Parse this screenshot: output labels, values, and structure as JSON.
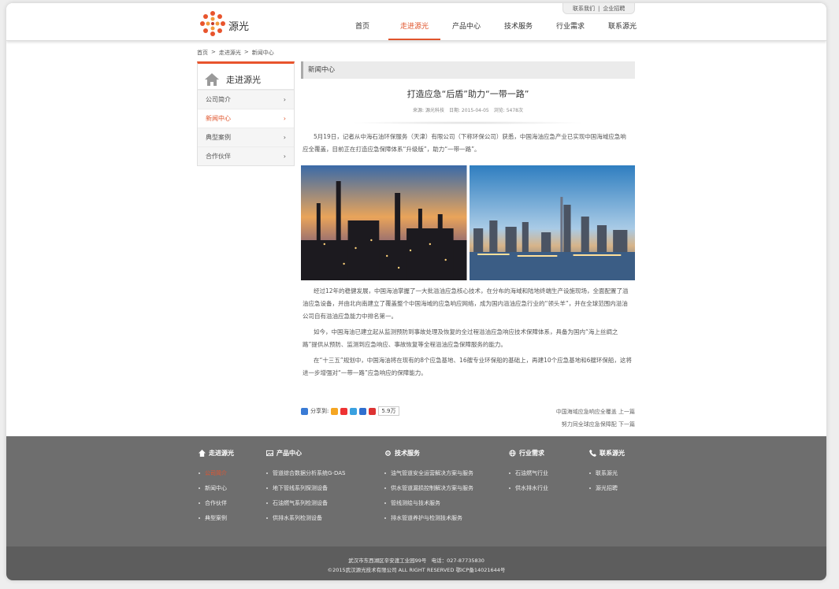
{
  "header": {
    "logo_text": "源光",
    "logo_subtext": "",
    "top_links": [
      "联系我们",
      "企业招聘"
    ],
    "top_links_sep": "|",
    "nav": [
      {
        "label": "首页"
      },
      {
        "label": "走进源光"
      },
      {
        "label": "产品中心"
      },
      {
        "label": "技术服务"
      },
      {
        "label": "行业需求"
      },
      {
        "label": "联系源光"
      }
    ],
    "nav_active": "走进源光"
  },
  "breadcrumb": [
    "首页",
    "走进源光",
    "新闻中心"
  ],
  "breadcrumb_sep": ">",
  "sidebar": {
    "title": "走进源光",
    "items": [
      {
        "label": "公司简介",
        "active": false
      },
      {
        "label": "新闻中心",
        "active": true
      },
      {
        "label": "典型案例",
        "active": false
      },
      {
        "label": "合作伙伴",
        "active": false
      }
    ],
    "chevron": "›"
  },
  "content": {
    "section_title": "新闻中心",
    "article_title": "打造应急“后盾”助力“一带一路”",
    "meta_source": "来源: 源光科技",
    "meta_date": "日期: 2015-04-05",
    "meta_views": "浏览: 5478次",
    "paragraphs": [
      "5月19日，记者从中海石油环保服务（天津）有限公司（下称环保公司）获悉，中国海油应急产业已实现中国海域应急响应全覆盖，目前正在打造应急保障体系“升级版”，助力“一带一路”。",
      "经过12年的稳健发展，中国海油掌握了一大批溢油应急核心技术，在分布的海域和陆地终端生产设施现场，全面配置了溢油应急设备，并由北向南建立了覆盖整个中国海域的应急响应网络，成为国内溢油应急行业的“领头羊”，并在全球范围内溢油公司自有溢油应急能力中排名第一。",
      "如今，中国海油已建立起从监测预防到事故处理及恢复的全过程溢油应急响应技术保障体系，具备为国内“海上丝绸之路”提供从预防、监测到应急响应、事故恢复等全程溢油应急保障服务的能力。",
      "在“十三五”规划中，中国海油将在现有的8个应急基地、16艘专业环保船的基础上，再建10个应急基地和6艘环保船，这将进一步增强对“一带一路”应急响应的保障能力。"
    ],
    "share_label": "分享到:",
    "share_count": "5.9万",
    "prev_link": "中国海域应急响应全覆盖 上一篇",
    "next_link": "努力同全球应急保障配 下一篇"
  },
  "footer": {
    "columns": [
      {
        "title": "走进源光",
        "icon": "home-icon",
        "links": [
          "公司简介",
          "新闻中心",
          "合作伙伴",
          "典型案例"
        ],
        "active_index": 0
      },
      {
        "title": "产品中心",
        "icon": "image-icon",
        "links": [
          "管道综合数据分析系统G-DAS",
          "地下管线系列探测设备",
          "石油燃气系列检测设备",
          "供排水系列检测设备"
        ],
        "active_index": -1
      },
      {
        "title": "技术服务",
        "icon": "gear-icon",
        "links": [
          "油气管道安全运营解决方案与服务",
          "供水管道漏损控制解决方案与服务",
          "管线测绘与技术服务",
          "排水管道养护与检测技术服务"
        ],
        "active_index": -1
      },
      {
        "title": "行业需求",
        "icon": "globe-icon",
        "links": [
          "石油燃气行业",
          "供水排水行业"
        ],
        "active_index": -1
      },
      {
        "title": "联系源光",
        "icon": "phone-icon",
        "links": [
          "联系源光",
          "源光招聘"
        ],
        "active_index": -1
      }
    ],
    "address": "武汉市东西湖区辛安渡工业园99号",
    "phone": "电话：027-87735830",
    "copyright": "©2015武汉源光技术有限公司 ALL RIGHT RESERVED 鄂ICP备14021644号"
  },
  "colors": {
    "accent": "#e0542b",
    "footer_bg": "#6e6e6e",
    "bottom_bg": "#5d5d5d"
  }
}
